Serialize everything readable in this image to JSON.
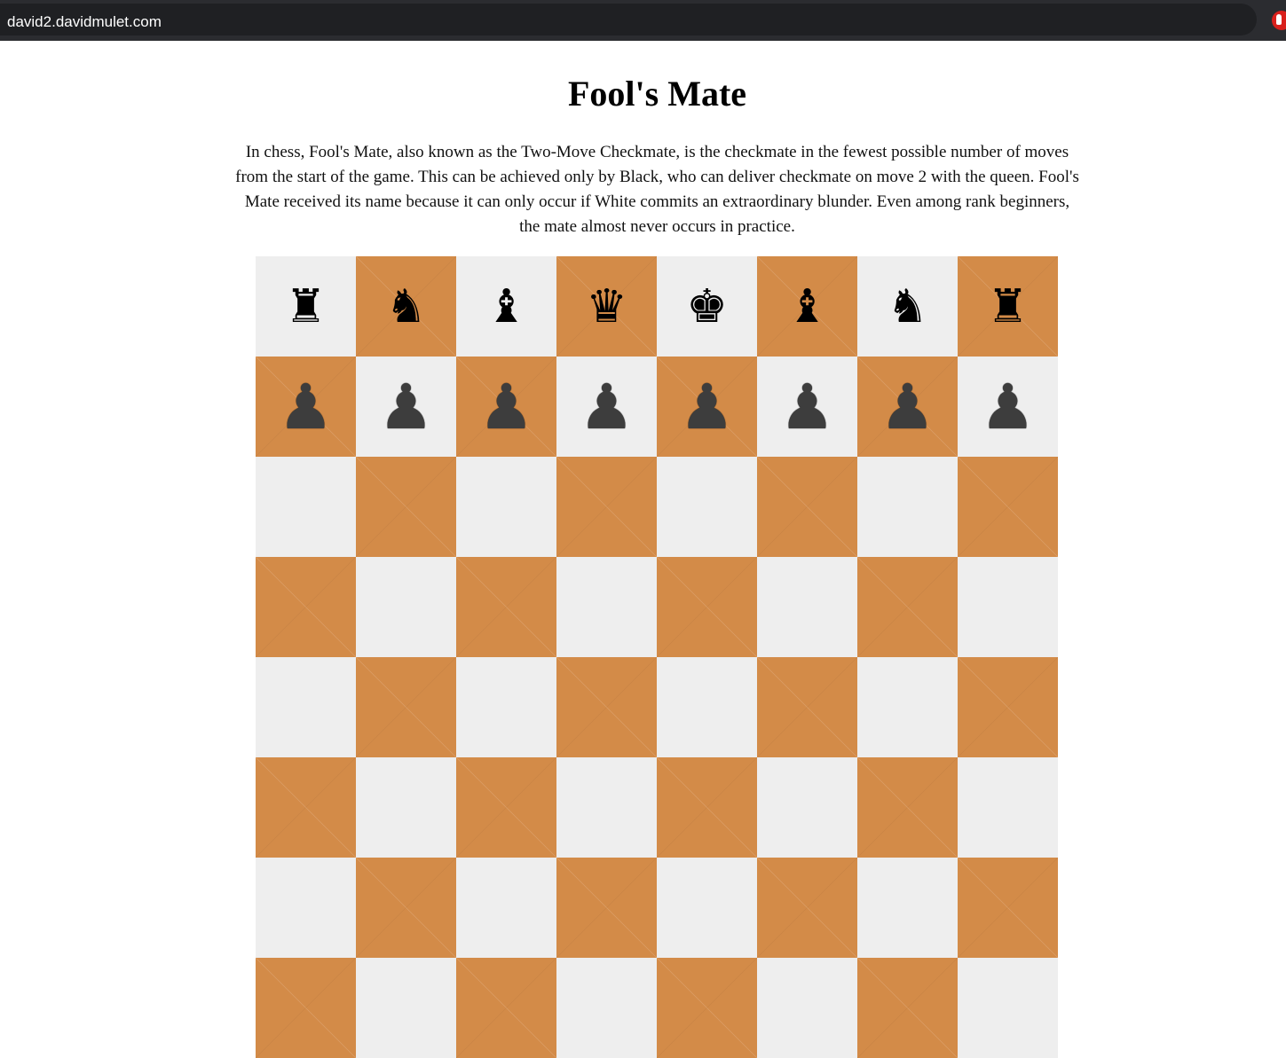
{
  "browser": {
    "url": "david2.davidmulet.com"
  },
  "page": {
    "title": "Fool's Mate",
    "intro": "In chess, Fool's Mate, also known as the Two-Move Checkmate, is the checkmate in the fewest possible number of moves from the start of the game. This can be achieved only by Black, who can deliver checkmate on move 2 with the queen. Fool's Mate received its name because it can only occur if White commits an extraordinary blunder. Even among rank beginners, the mate almost never occurs in practice."
  },
  "board": {
    "colors": {
      "light": "#eeeeee",
      "dark": "#d38b48"
    },
    "ranks": [
      [
        "black-rook",
        "black-knight",
        "black-bishop",
        "black-queen",
        "black-king",
        "black-bishop",
        "black-knight",
        "black-rook"
      ],
      [
        "black-pawn",
        "black-pawn",
        "black-pawn",
        "black-pawn",
        "black-pawn",
        "black-pawn",
        "black-pawn",
        "black-pawn"
      ],
      [
        "",
        "",
        "",
        "",
        "",
        "",
        "",
        ""
      ],
      [
        "",
        "",
        "",
        "",
        "",
        "",
        "",
        ""
      ],
      [
        "",
        "",
        "",
        "",
        "",
        "",
        "",
        ""
      ],
      [
        "",
        "",
        "",
        "",
        "",
        "",
        "",
        ""
      ],
      [
        "",
        "",
        "",
        "",
        "",
        "",
        "",
        ""
      ],
      [
        "",
        "",
        "",
        "",
        "",
        "",
        "",
        ""
      ]
    ]
  }
}
